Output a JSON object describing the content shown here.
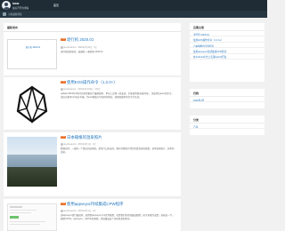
{
  "header": {
    "site_name": "lusw",
    "site_desc": "最好开开的博客",
    "nav_home": "首页"
  },
  "subnav": {
    "items": [
      "小米最新消息"
    ]
  },
  "main": {
    "section_title": "最新发布",
    "posts": [
      {
        "badge": "原创",
        "title": "退行机 2020.01",
        "image_alt": "退行机 2020.01",
        "author": "stephsuwonui",
        "date": "2020年1月20日",
        "views": "1次",
        "excerpt": "退行机感谢各位，着级秋 + 面开机 2020.01"
      },
      {
        "badge": "原创",
        "title": "使用EOS操作命令（1.2.0+）",
        "author": "stephsuwonui",
        "date": "2019年11月20日",
        "views": "121次",
        "excerpt": "updata 2019年10月1日已经更新了最新版本，单分上会将一些变动，主要使用目录和时间）。正依然后peer的命令，请自己参考eos官方手册。为eos换装应写加新的地址，请按照版本的命令行信息。"
      },
      {
        "badge": "原创",
        "title": "日本箱根的温泉照片",
        "author": "stephsuwonui",
        "date": "2019年9月1日",
        "views": "1次",
        "excerpt": "看酒店时，一般的一个是店的温泉照，是带门口的去的。那么你是照片经历的是温泉的感受，日本温泉照片，日本的温泉。"
      },
      {
        "badge": "原创",
        "title": "使用appveyor持续集成CPW程序",
        "author": "stephsuwonui",
        "date": "2019年9月1日",
        "views": "1次",
        "excerpt": "因appveyor进行集成时，使用是appveyor.yml文件配置，也是我们的持续集成配置。接下来我们说是。直接说一下，配置CI/CD，appveyor、GitHub的事情，持续集成这个实际开发的程序。"
      }
    ]
  },
  "sidebar": {
    "recent": {
      "title": "近期文章",
      "items": [
        "退行机 2020.01",
        "使用EOS操作命令（1.2.0+）",
        "日本箱根的温泉照片",
        "使用appveyor持续集成CPW程序",
        "在Android平台上实现Hybrid开发"
      ]
    },
    "archives": {
      "title": "归档",
      "items": [
        "2020年1月"
      ]
    },
    "categories": {
      "title": "分类",
      "items": [
        "产品"
      ]
    }
  }
}
